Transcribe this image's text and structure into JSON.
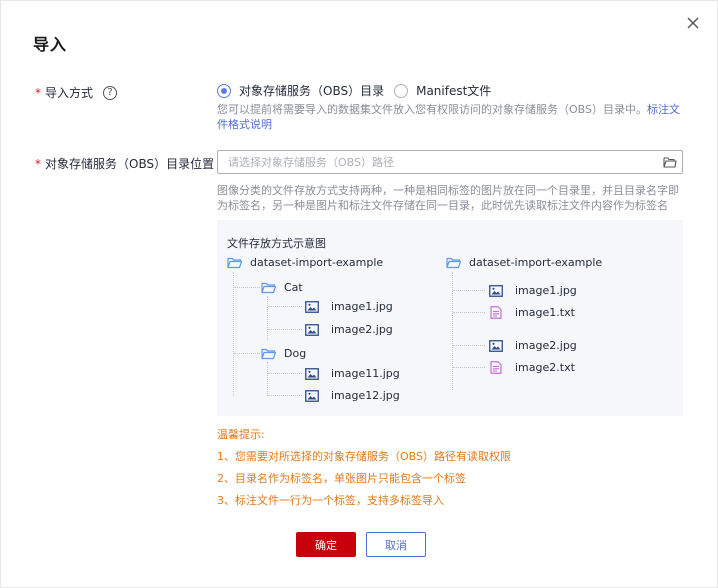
{
  "dialog": {
    "title": "导入"
  },
  "import_method": {
    "label": "导入方式",
    "options": [
      {
        "label": "对象存储服务（OBS）目录",
        "checked": true
      },
      {
        "label": "Manifest文件",
        "checked": false
      }
    ],
    "hint": "您可以提前将需要导入的数据集文件放入您有权限访问的对象存储服务（OBS）目录中。",
    "hint_link": "标注文件格式说明"
  },
  "obs_location": {
    "label": "对象存储服务（OBS）目录位置",
    "placeholder": "请选择对象存储服务（OBS）路径",
    "value": "",
    "hint": "图像分类的文件存放方式支持两种，一种是相同标签的图片放在同一个目录里，并且目录名字即为标签名，另一种是图片和标注文件存储在同一目录，此时优先读取标注文件内容作为标签名"
  },
  "example": {
    "title": "文件存放方式示意图",
    "left_tree": {
      "root": "dataset-import-example",
      "folders": [
        {
          "name": "Cat",
          "files": [
            "image1.jpg",
            "image2.jpg"
          ]
        },
        {
          "name": "Dog",
          "files": [
            "image11.jpg",
            "image12.jpg"
          ]
        }
      ]
    },
    "right_tree": {
      "root": "dataset-import-example",
      "files": [
        {
          "name": "image1.jpg",
          "type": "image"
        },
        {
          "name": "image1.txt",
          "type": "text"
        },
        {
          "name": "image2.jpg",
          "type": "image"
        },
        {
          "name": "image2.txt",
          "type": "text"
        }
      ]
    }
  },
  "tips": {
    "title": "温馨提示:",
    "items": [
      "1、您需要对所选择的对象存储服务（OBS）路径有读取权限",
      "2、目录名作为标签名，单张图片只能包含一个标签",
      "3、标注文件一行为一个标签，支持多标签导入"
    ]
  },
  "buttons": {
    "confirm": "确定",
    "cancel": "取消"
  },
  "colors": {
    "primary_red": "#c7000b",
    "link_blue": "#526ecc",
    "radio_blue": "#5e7ce0",
    "tip_orange": "#e37a1a",
    "required_red": "#e02020",
    "folder_blue": "#5e9bf0",
    "image_icon": "#2f4b8a",
    "text_icon": "#c470d4"
  },
  "icons": {
    "close": "close-icon",
    "help": "question-circle-icon",
    "folder_open": "folder-open-icon",
    "folder": "folder-icon",
    "image_file": "image-file-icon",
    "text_file": "text-file-icon"
  }
}
